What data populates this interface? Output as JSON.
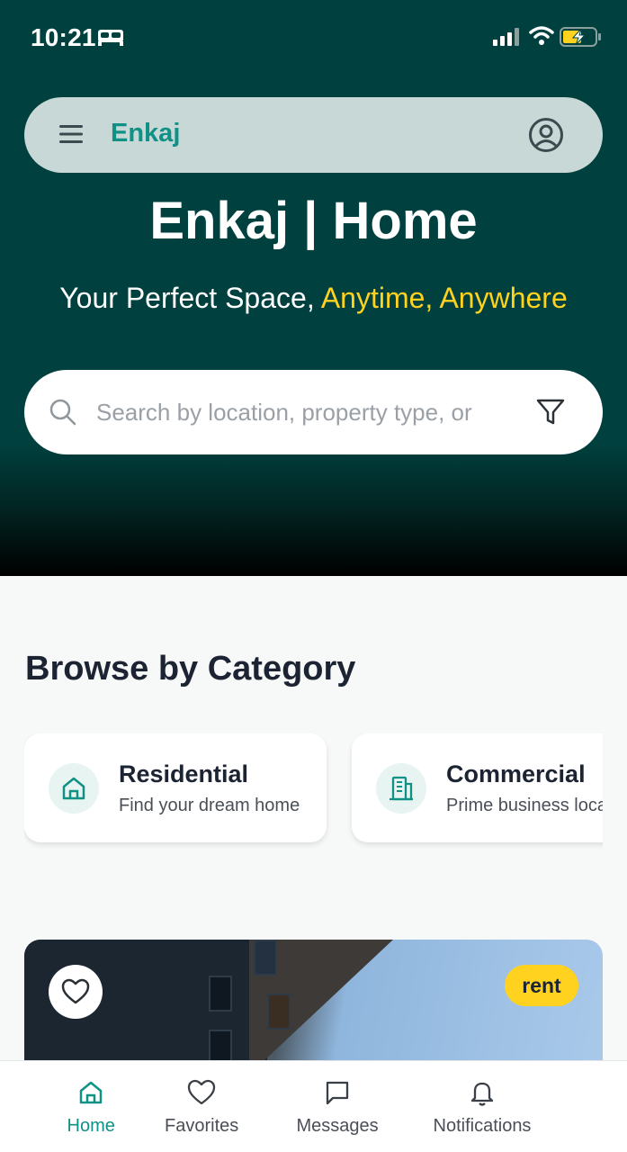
{
  "status_bar": {
    "time": "10:21"
  },
  "topbar": {
    "brand": "Enkaj"
  },
  "hero": {
    "title": "Enkaj | Home",
    "subtitle_plain": "Your Perfect Space, ",
    "subtitle_highlight": "Anytime, Anywhere"
  },
  "search": {
    "placeholder": "Search by location, property type, or"
  },
  "categories_section": {
    "title": "Browse by Category",
    "items": [
      {
        "label": "Residential",
        "description": "Find your dream home",
        "icon": "home-icon"
      },
      {
        "label": "Commercial",
        "description": "Prime business locations",
        "icon": "office-building-icon"
      }
    ]
  },
  "listing": {
    "badge": "rent"
  },
  "bottom_nav": {
    "items": [
      {
        "label": "Home",
        "icon": "home-icon",
        "active": true
      },
      {
        "label": "Favorites",
        "icon": "heart-icon",
        "active": false
      },
      {
        "label": "Messages",
        "icon": "chat-icon",
        "active": false
      },
      {
        "label": "Notifications",
        "icon": "bell-icon",
        "active": false
      }
    ]
  },
  "colors": {
    "hero_bg": "#00413f",
    "accent": "#109186",
    "highlight": "#ffd21f",
    "text_dark": "#1c2333"
  }
}
